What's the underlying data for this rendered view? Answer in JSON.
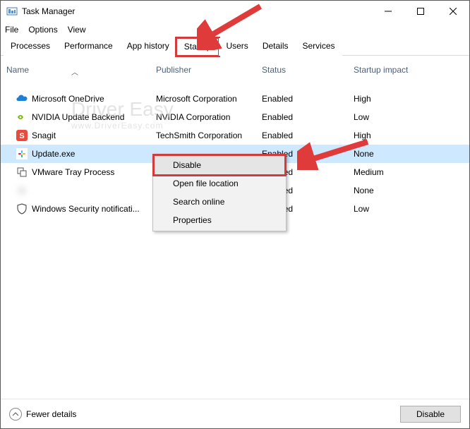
{
  "window": {
    "title": "Task Manager"
  },
  "menubar": [
    "File",
    "Options",
    "View"
  ],
  "tabs": [
    "Processes",
    "Performance",
    "App history",
    "Startup",
    "Users",
    "Details",
    "Services"
  ],
  "active_tab": "Startup",
  "columns": {
    "name": "Name",
    "publisher": "Publisher",
    "status": "Status",
    "impact": "Startup impact"
  },
  "rows": [
    {
      "icon": "onedrive",
      "name": "Microsoft OneDrive",
      "publisher": "Microsoft Corporation",
      "status": "Enabled",
      "impact": "High",
      "selected": false
    },
    {
      "icon": "nvidia",
      "name": "NVIDIA Update Backend",
      "publisher": "NVIDIA Corporation",
      "status": "Enabled",
      "impact": "Low",
      "selected": false
    },
    {
      "icon": "snagit",
      "name": "Snagit",
      "publisher": "TechSmith Corporation",
      "status": "Enabled",
      "impact": "High",
      "selected": false
    },
    {
      "icon": "slack",
      "name": "Update.exe",
      "publisher": "",
      "status": "Enabled",
      "impact": "None",
      "selected": true
    },
    {
      "icon": "vmware",
      "name": "VMware Tray Process",
      "publisher": "",
      "status": "Enabled",
      "impact": "Medium",
      "selected": false
    },
    {
      "icon": "blank",
      "name": "",
      "publisher": "",
      "status": "Enabled",
      "impact": "None",
      "selected": false,
      "blurred": true
    },
    {
      "icon": "shield",
      "name": "Windows Security notificati...",
      "publisher": "",
      "status": "Enabled",
      "impact": "Low",
      "selected": false
    }
  ],
  "context_menu": {
    "items": [
      "Disable",
      "Open file location",
      "Search online",
      "Properties"
    ],
    "highlighted": "Disable"
  },
  "footer": {
    "fewer_details": "Fewer details",
    "disable_button": "Disable"
  },
  "watermark": {
    "line1": "Driver Easy",
    "line2": "www.DriverEasy.com"
  }
}
